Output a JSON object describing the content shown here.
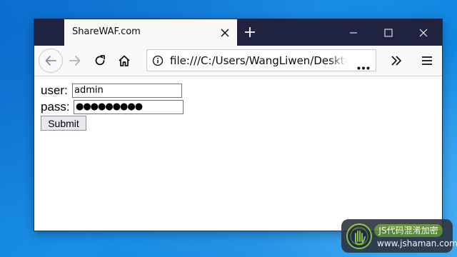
{
  "browser": {
    "tab_title": "ShareWAF.com",
    "url": "file:///C:/Users/WangLiwen/Desktop/",
    "icons": {
      "tab_close": "close-icon",
      "new_tab": "plus-icon",
      "minimize": "minimize-icon",
      "maximize": "maximize-icon",
      "close": "close-icon",
      "back": "back-arrow-icon",
      "forward": "forward-arrow-icon",
      "reload": "reload-icon",
      "home": "home-icon",
      "info": "info-icon",
      "page_actions": "more-horizontal-icon",
      "overflow": "chevron-double-right-icon",
      "menu": "hamburger-menu-icon"
    }
  },
  "form": {
    "user_label": "user:",
    "user_value": "admin",
    "pass_label": "pass:",
    "pass_value": "●●●●●●●●●",
    "submit_label": "Submit"
  },
  "watermark": {
    "badge": "JS代码混淆加密",
    "url": "www.jshaman.com"
  },
  "colors": {
    "titlebar": "#202340",
    "toolbar": "#f9f9fa",
    "desktop": "#0a78d7",
    "watermark_badge": "#5a8a2a"
  }
}
